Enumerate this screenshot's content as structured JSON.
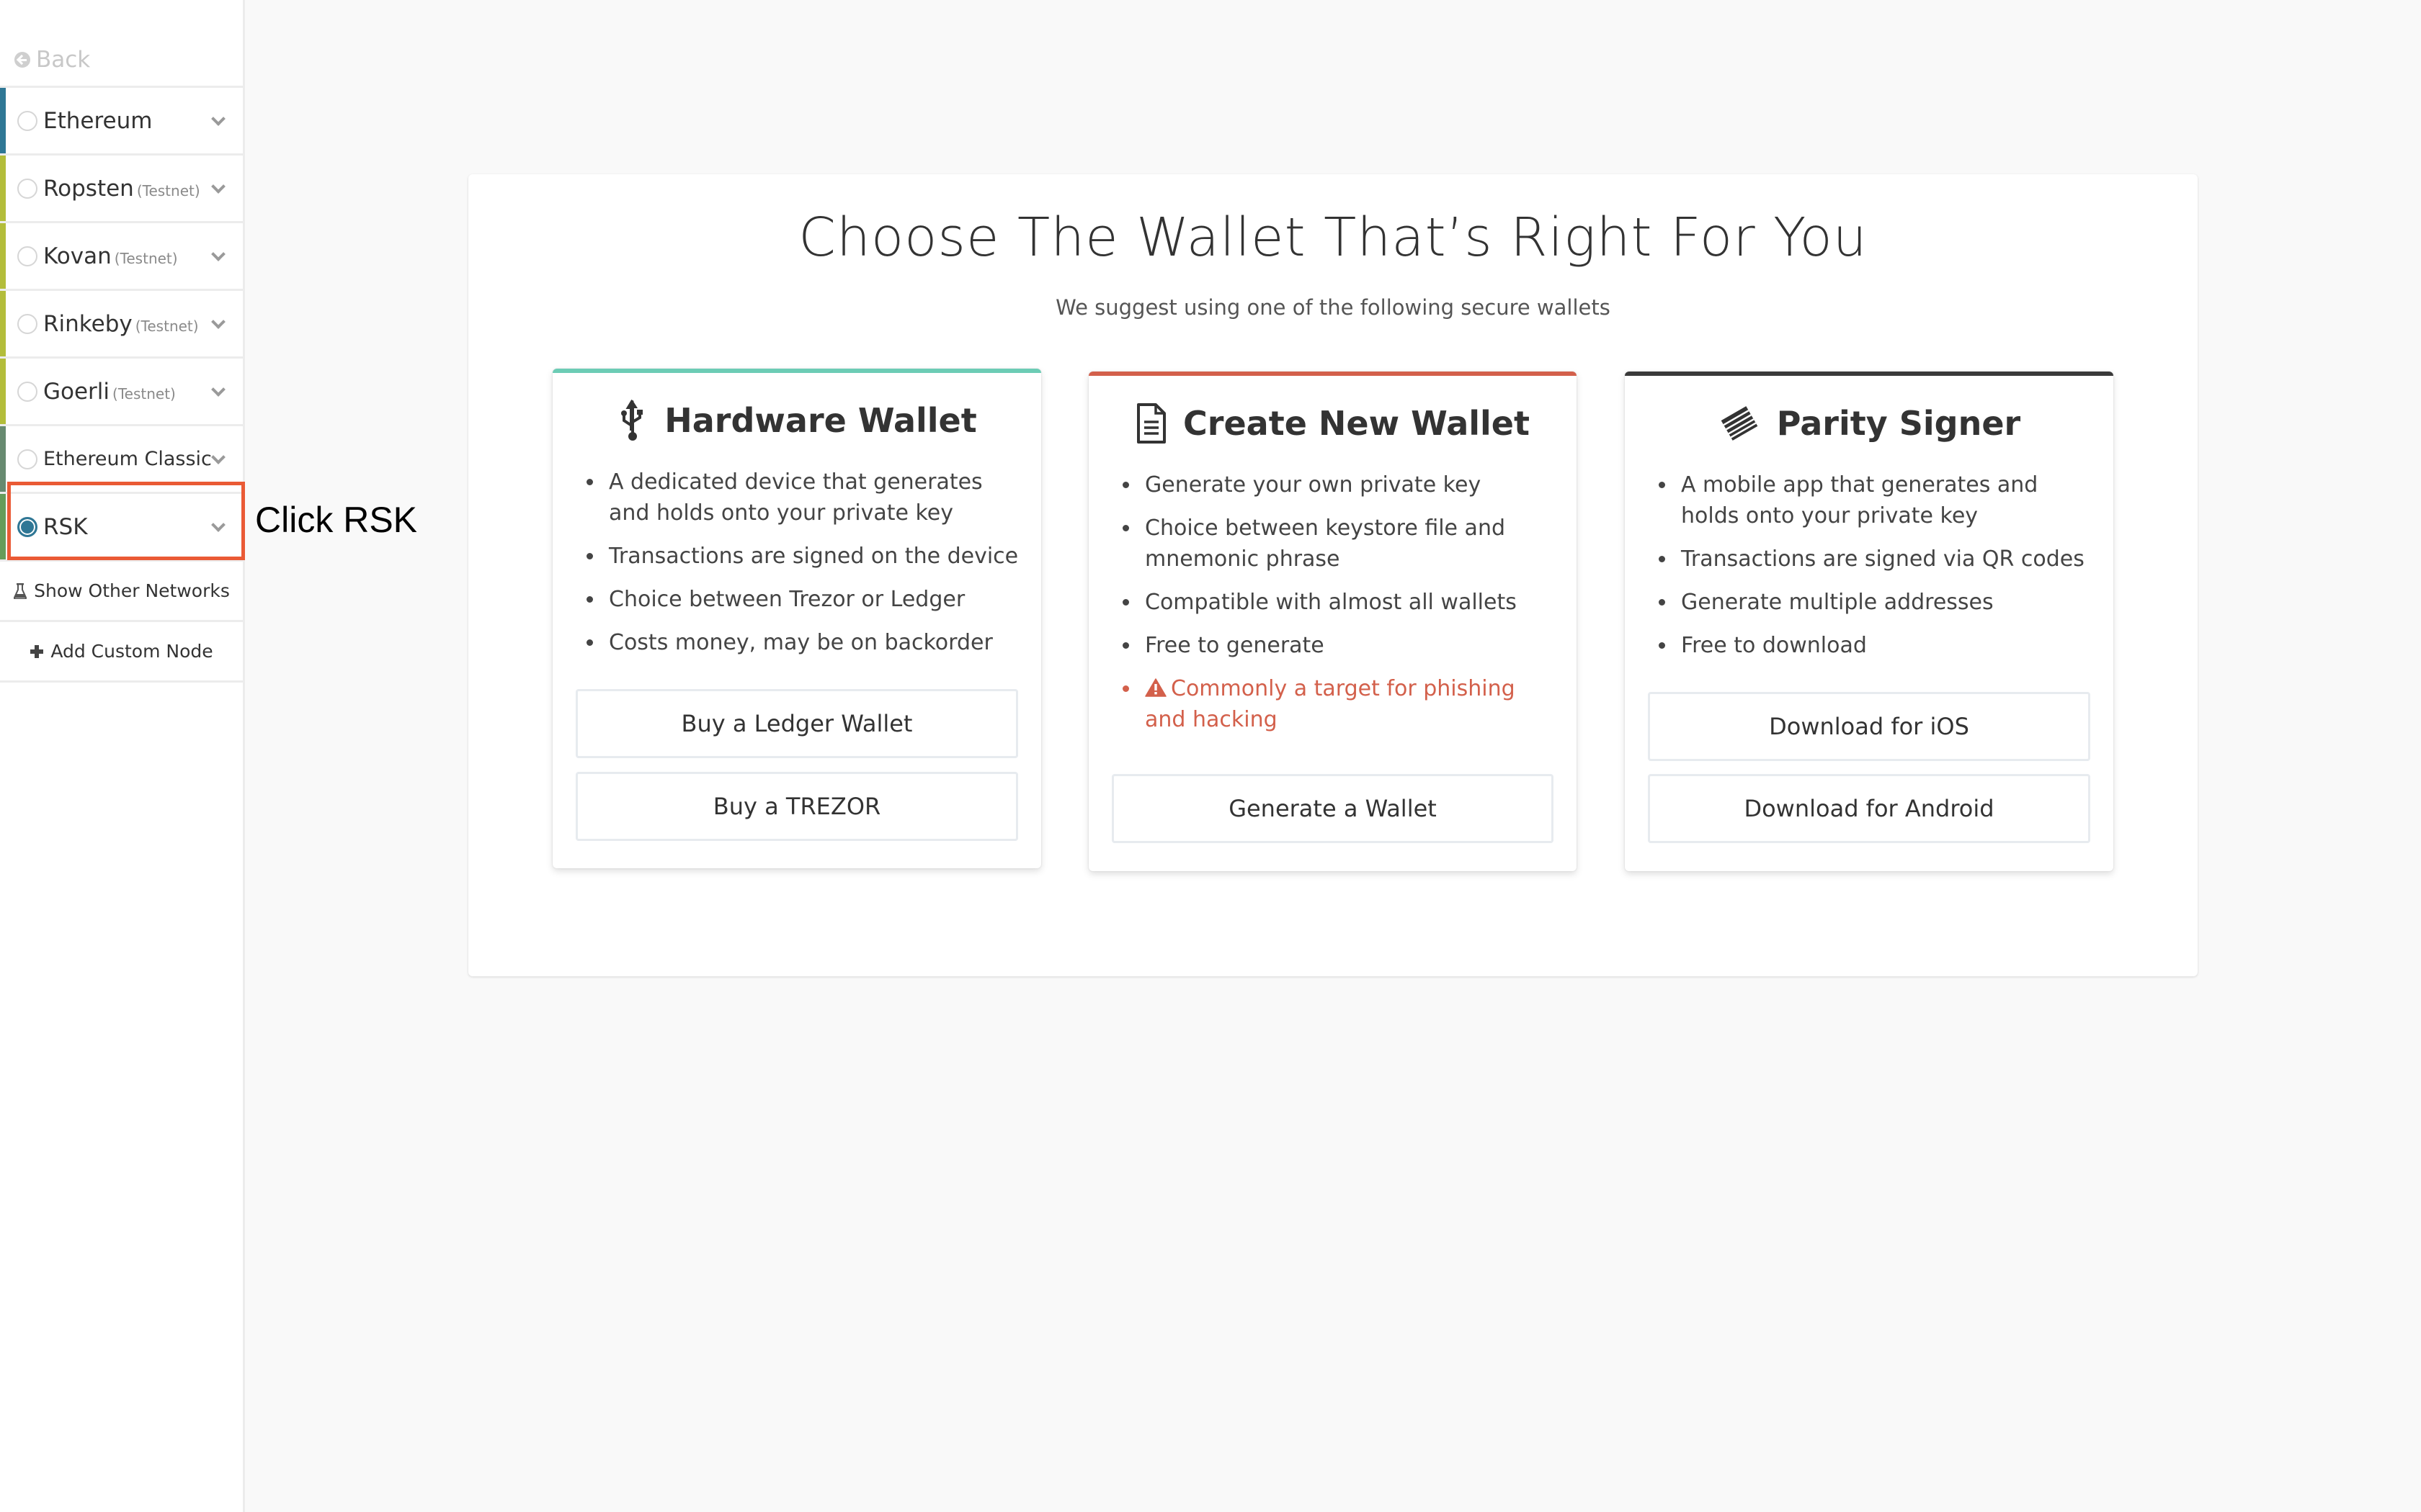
{
  "sidebar": {
    "back_label": "Back",
    "networks": [
      {
        "name": "Ethereum",
        "tag": "",
        "color": "#2f7795",
        "selected": false
      },
      {
        "name": "Ropsten",
        "tag": "(Testnet)",
        "color": "#b3bd3a",
        "selected": false
      },
      {
        "name": "Kovan",
        "tag": "(Testnet)",
        "color": "#b3bd3a",
        "selected": false
      },
      {
        "name": "Rinkeby",
        "tag": "(Testnet)",
        "color": "#b3bd3a",
        "selected": false
      },
      {
        "name": "Goerli",
        "tag": "(Testnet)",
        "color": "#b3bd3a",
        "selected": false
      },
      {
        "name": "Ethereum Classic",
        "tag": "",
        "color": "#678a70",
        "selected": false
      },
      {
        "name": "RSK",
        "tag": "",
        "color": "#669c5a",
        "selected": true
      }
    ],
    "show_other_networks": "Show Other Networks",
    "add_custom_node": "Add Custom Node"
  },
  "annotation": {
    "text": "Click RSK",
    "color": "#ea5a35"
  },
  "main": {
    "title": "Choose The Wallet That’s Right For You",
    "subtitle": "We suggest using one of the following secure wallets",
    "cards": [
      {
        "title": "Hardware Wallet",
        "icon": "usb-icon",
        "accent": "#6cccb5",
        "bullets": [
          "A dedicated device that generates and holds onto your private key",
          "Transactions are signed on the device",
          "Choice between Trezor or Ledger",
          "Costs money, may be on backorder"
        ],
        "buttons": [
          "Buy a Ledger Wallet",
          "Buy a TREZOR"
        ]
      },
      {
        "title": "Create New Wallet",
        "icon": "document-icon",
        "accent": "#d3604b",
        "bullets": [
          "Generate your own private key",
          "Choice between keystore file and mnemonic phrase",
          "Compatible with almost all wallets",
          "Free to generate"
        ],
        "warning": "Commonly a target for phishing and hacking",
        "buttons": [
          "Generate a Wallet"
        ]
      },
      {
        "title": "Parity Signer",
        "icon": "parity-signer-icon",
        "accent": "#3a3a3a",
        "bullets": [
          "A mobile app that generates and holds onto your private key",
          "Transactions are signed via QR codes",
          "Generate multiple addresses",
          "Free to download"
        ],
        "buttons": [
          "Download for iOS",
          "Download for Android"
        ]
      }
    ]
  }
}
